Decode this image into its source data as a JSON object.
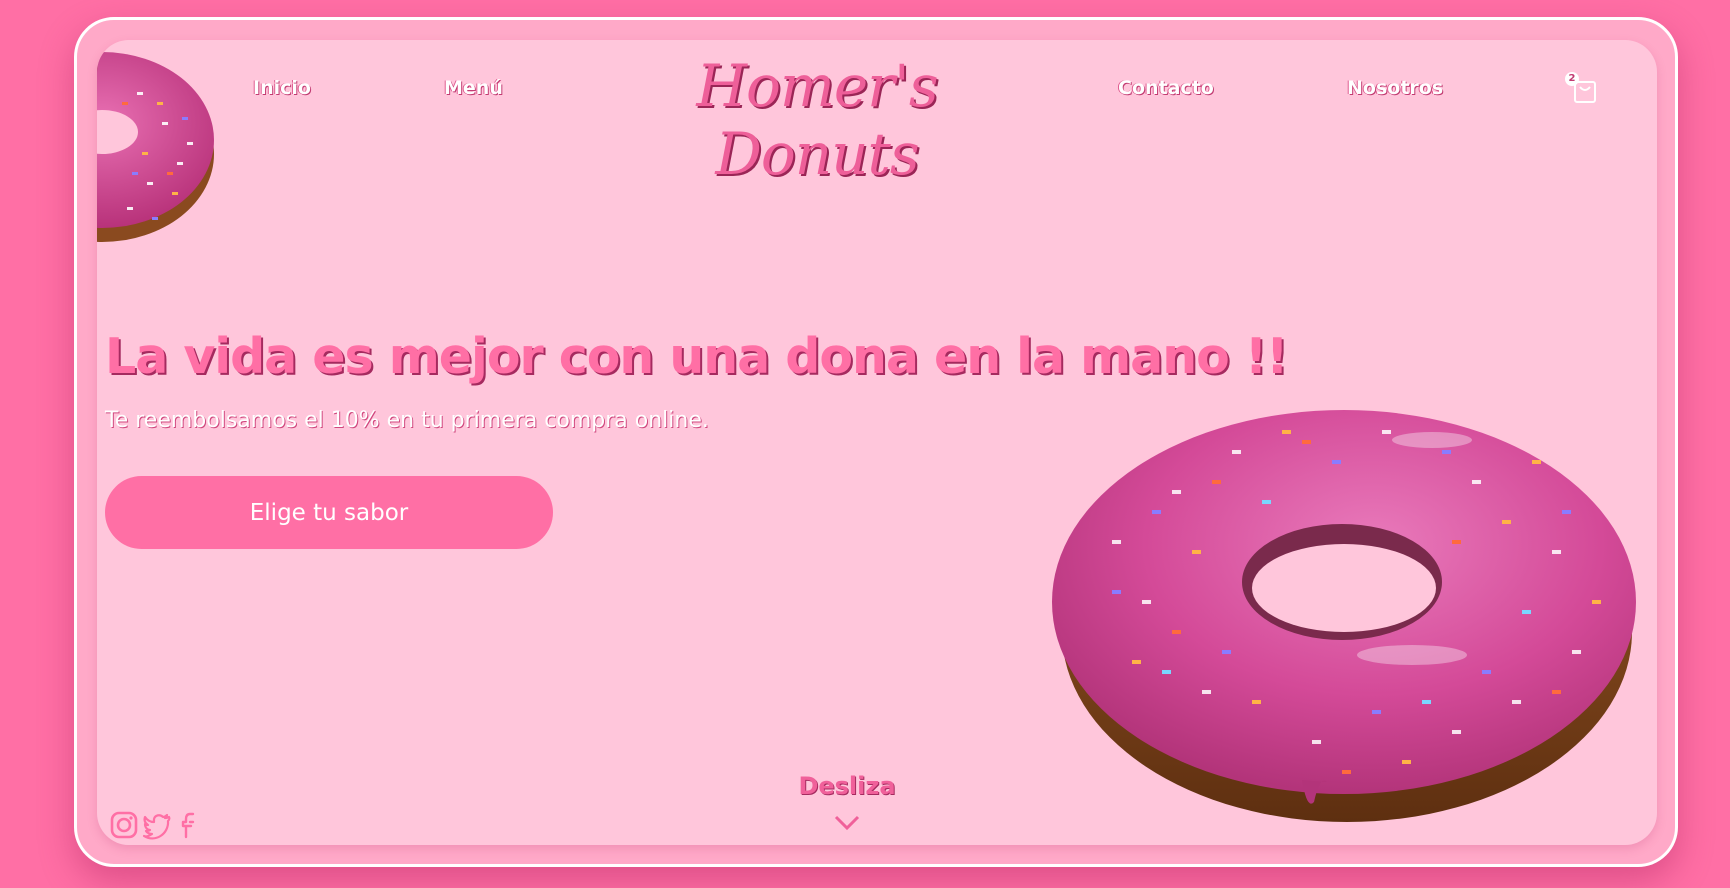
{
  "brand": {
    "name": "Homer's Donuts"
  },
  "nav": {
    "left": [
      {
        "label": "Inicio"
      },
      {
        "label": "Menú"
      }
    ],
    "right": [
      {
        "label": "Contacto"
      },
      {
        "label": "Nosotros"
      }
    ]
  },
  "cart": {
    "count": "2",
    "icon": "shopping-bag-icon"
  },
  "hero": {
    "title": "La vida es mejor con una dona en la mano !!",
    "subtitle": "Te reembolsamos el 10% en tu primera compra online.",
    "cta_label": "Elige tu sabor"
  },
  "scroll": {
    "label": "Desliza",
    "icon": "chevron-down-icon"
  },
  "social": [
    {
      "icon": "instagram-icon"
    },
    {
      "icon": "twitter-icon"
    },
    {
      "icon": "facebook-icon"
    }
  ],
  "colors": {
    "page_background": "#ff6fa5",
    "card_background": "#ffc6db",
    "accent": "#ff6fa5",
    "frosting": "#d44a98",
    "white": "#ffffff"
  }
}
